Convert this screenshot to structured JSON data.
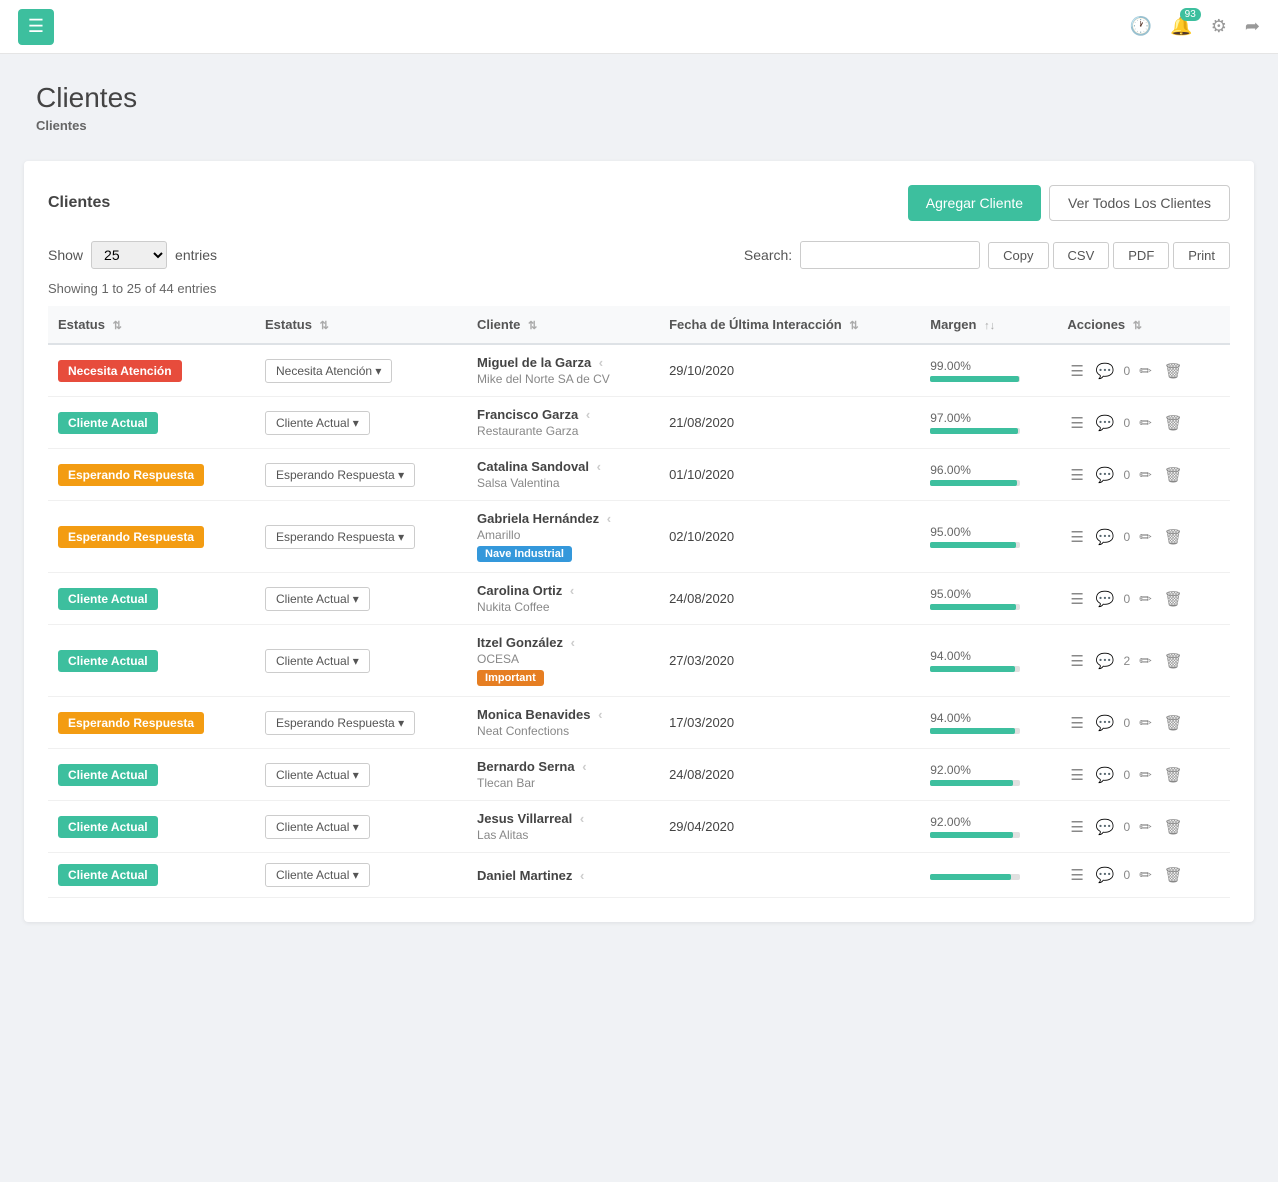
{
  "topnav": {
    "hamburger_icon": "☰",
    "notif_count": "93",
    "clock_icon": "🕐",
    "bell_icon": "🔔",
    "gear_icon": "⚙",
    "share_icon": "➦"
  },
  "page": {
    "title": "Clientes",
    "breadcrumb": "Clientes"
  },
  "card": {
    "title": "Clientes",
    "add_button": "Agregar Cliente",
    "view_all_button": "Ver Todos Los Clientes"
  },
  "controls": {
    "show_label": "Show",
    "show_value": "25",
    "entries_label": "entries",
    "search_label": "Search:",
    "search_placeholder": "",
    "copy_button": "Copy",
    "csv_button": "CSV",
    "pdf_button": "PDF",
    "print_button": "Print"
  },
  "table": {
    "showing_info": "Showing 1 to 25 of 44 entries",
    "columns": [
      "Estatus",
      "Estatus",
      "Cliente",
      "Fecha de Última Interacción",
      "Margen",
      "Acciones"
    ],
    "rows": [
      {
        "badge_label": "Necesita Atención",
        "badge_class": "badge-red",
        "dropdown_label": "Necesita Atención",
        "client_name": "Miguel de la Garza",
        "client_company": "Mike del Norte SA de CV",
        "client_tag": null,
        "fecha": "29/10/2020",
        "margen_pct": "99.00%",
        "margen_fill": 99,
        "comments": "0"
      },
      {
        "badge_label": "Cliente Actual",
        "badge_class": "badge-teal",
        "dropdown_label": "Cliente Actual",
        "client_name": "Francisco Garza",
        "client_company": "Restaurante Garza",
        "client_tag": null,
        "fecha": "21/08/2020",
        "margen_pct": "97.00%",
        "margen_fill": 97,
        "comments": "0"
      },
      {
        "badge_label": "Esperando Respuesta",
        "badge_class": "badge-orange",
        "dropdown_label": "Esperando Respuesta",
        "client_name": "Catalina Sandoval",
        "client_company": "Salsa Valentina",
        "client_tag": null,
        "fecha": "01/10/2020",
        "margen_pct": "96.00%",
        "margen_fill": 96,
        "comments": "0"
      },
      {
        "badge_label": "Esperando Respuesta",
        "badge_class": "badge-orange",
        "dropdown_label": "Esperando Respuesta",
        "client_name": "Gabriela Hernández",
        "client_company": "Amarillo",
        "client_tag": "Nave Industrial",
        "client_tag_class": "tag-blue",
        "fecha": "02/10/2020",
        "margen_pct": "95.00%",
        "margen_fill": 95,
        "comments": "0"
      },
      {
        "badge_label": "Cliente Actual",
        "badge_class": "badge-teal",
        "dropdown_label": "Cliente Actual",
        "client_name": "Carolina Ortiz",
        "client_company": "Nukita Coffee",
        "client_tag": null,
        "fecha": "24/08/2020",
        "margen_pct": "95.00%",
        "margen_fill": 95,
        "comments": "0"
      },
      {
        "badge_label": "Cliente Actual",
        "badge_class": "badge-teal",
        "dropdown_label": "Cliente Actual",
        "client_name": "Itzel González",
        "client_company": "OCESA",
        "client_tag": "Important",
        "client_tag_class": "tag-orange",
        "fecha": "27/03/2020",
        "margen_pct": "94.00%",
        "margen_fill": 94,
        "comments": "2"
      },
      {
        "badge_label": "Esperando Respuesta",
        "badge_class": "badge-orange",
        "dropdown_label": "Esperando Respuesta",
        "client_name": "Monica Benavides",
        "client_company": "Neat Confections",
        "client_tag": null,
        "fecha": "17/03/2020",
        "margen_pct": "94.00%",
        "margen_fill": 94,
        "comments": "0"
      },
      {
        "badge_label": "Cliente Actual",
        "badge_class": "badge-teal",
        "dropdown_label": "Cliente Actual",
        "client_name": "Bernardo Serna",
        "client_company": "Tlecan Bar",
        "client_tag": null,
        "fecha": "24/08/2020",
        "margen_pct": "92.00%",
        "margen_fill": 92,
        "comments": "0"
      },
      {
        "badge_label": "Cliente Actual",
        "badge_class": "badge-teal",
        "dropdown_label": "Cliente Actual",
        "client_name": "Jesus Villarreal",
        "client_company": "Las Alitas",
        "client_tag": null,
        "fecha": "29/04/2020",
        "margen_pct": "92.00%",
        "margen_fill": 92,
        "comments": "0"
      },
      {
        "badge_label": "Cliente Actual",
        "badge_class": "badge-teal",
        "dropdown_label": "Cliente Actual",
        "client_name": "Daniel Martinez",
        "client_company": "",
        "client_tag": null,
        "fecha": "",
        "margen_pct": "",
        "margen_fill": 90,
        "comments": "0"
      }
    ]
  }
}
